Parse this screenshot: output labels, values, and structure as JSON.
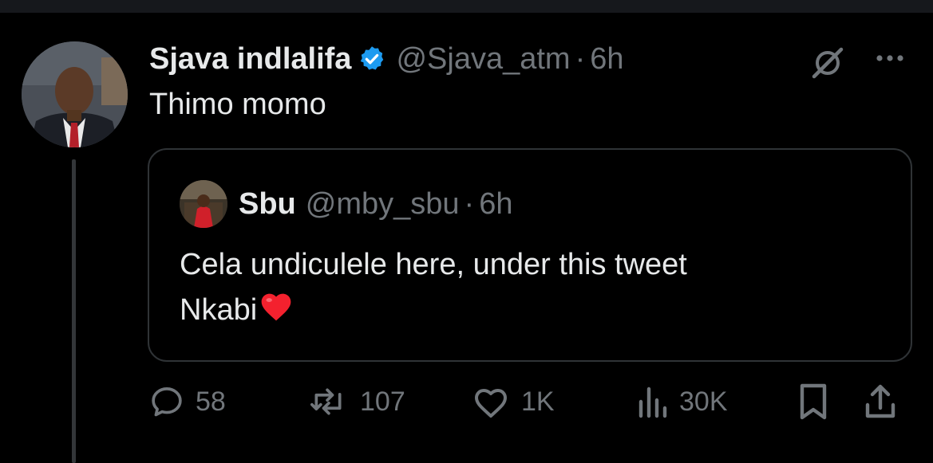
{
  "tweet": {
    "author_name": "Sjava indlalifa",
    "handle": "@Sjava_atm",
    "dot": "·",
    "time": "6h",
    "text": "Thimo momo"
  },
  "quoted_tweet": {
    "author_name": "Sbu",
    "handle": "@mby_sbu",
    "dot": "·",
    "time": "6h",
    "line1": "Cela undiculele here, under this tweet",
    "line2": "Nkabi"
  },
  "actions": {
    "replies": "58",
    "reposts": "107",
    "likes": "1K",
    "views": "30K"
  },
  "icons": {
    "verified": "verified-badge-icon",
    "grok": "grok-icon",
    "more": "more-options-icon",
    "reply": "reply-icon",
    "repost": "repost-icon",
    "like": "heart-icon",
    "views": "views-icon",
    "bookmark": "bookmark-icon",
    "share": "share-icon",
    "heart_emoji": "red-heart-emoji"
  },
  "colors": {
    "background": "#000000",
    "text": "#e7e9ea",
    "secondary": "#71767b",
    "border": "#2f3336",
    "verified": "#1d9bf0",
    "heart": "#f4212e"
  }
}
